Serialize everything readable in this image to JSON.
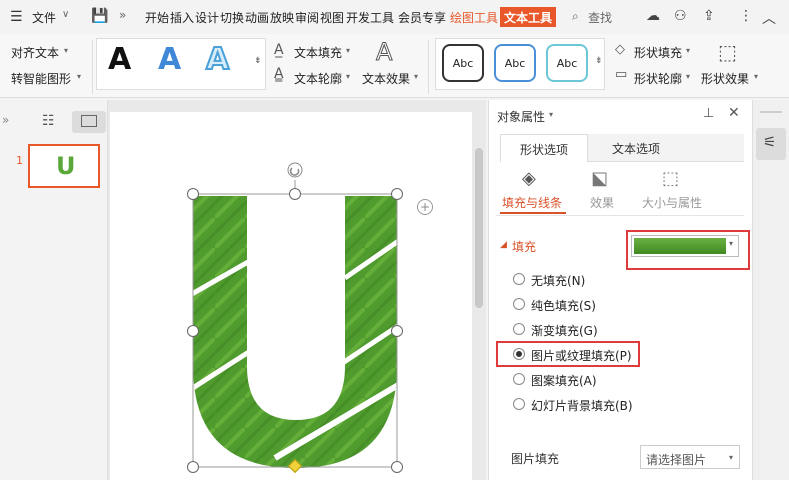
{
  "menubar": {
    "file_label": "文件",
    "tabs": [
      "开始",
      "插入",
      "设计",
      "切换",
      "动画",
      "放映",
      "审阅",
      "视图",
      "开发工具",
      "会员专享"
    ],
    "drawing_tools": "绘图工具",
    "text_tools": "文本工具",
    "search": "查找"
  },
  "ribbon": {
    "align_text": "对齐文本",
    "convert_smart": "转智能图形",
    "text_fill": "文本填充",
    "text_outline": "文本轮廓",
    "text_effect": "文本效果",
    "abc_label": "Abc",
    "shape_fill": "形状填充",
    "shape_outline": "形状轮廓",
    "shape_effect": "形状效果",
    "letter": "A"
  },
  "thumbnail": {
    "number": "1",
    "letter": "U"
  },
  "slide": {
    "letter": "U"
  },
  "panel": {
    "title": "对象属性",
    "tab_shape": "形状选项",
    "tab_text": "文本选项",
    "sub_fill": "填充与线条",
    "sub_effect": "效果",
    "sub_size": "大小与属性",
    "fill_header": "填充",
    "options": [
      {
        "label": "无填充(N)",
        "selected": false
      },
      {
        "label": "纯色填充(S)",
        "selected": false
      },
      {
        "label": "渐变填充(G)",
        "selected": false
      },
      {
        "label": "图片或纹理填充(P)",
        "selected": true
      },
      {
        "label": "图案填充(A)",
        "selected": false
      },
      {
        "label": "幻灯片背景填充(B)",
        "selected": false
      }
    ],
    "picture_fill_label": "图片填充",
    "picture_fill_placeholder": "请选择图片"
  },
  "colors": {
    "accent": "#d9532a",
    "text_tools_bg": "#e8582b",
    "highlight": "#e03b3b",
    "grass": "#4f9b2e"
  }
}
